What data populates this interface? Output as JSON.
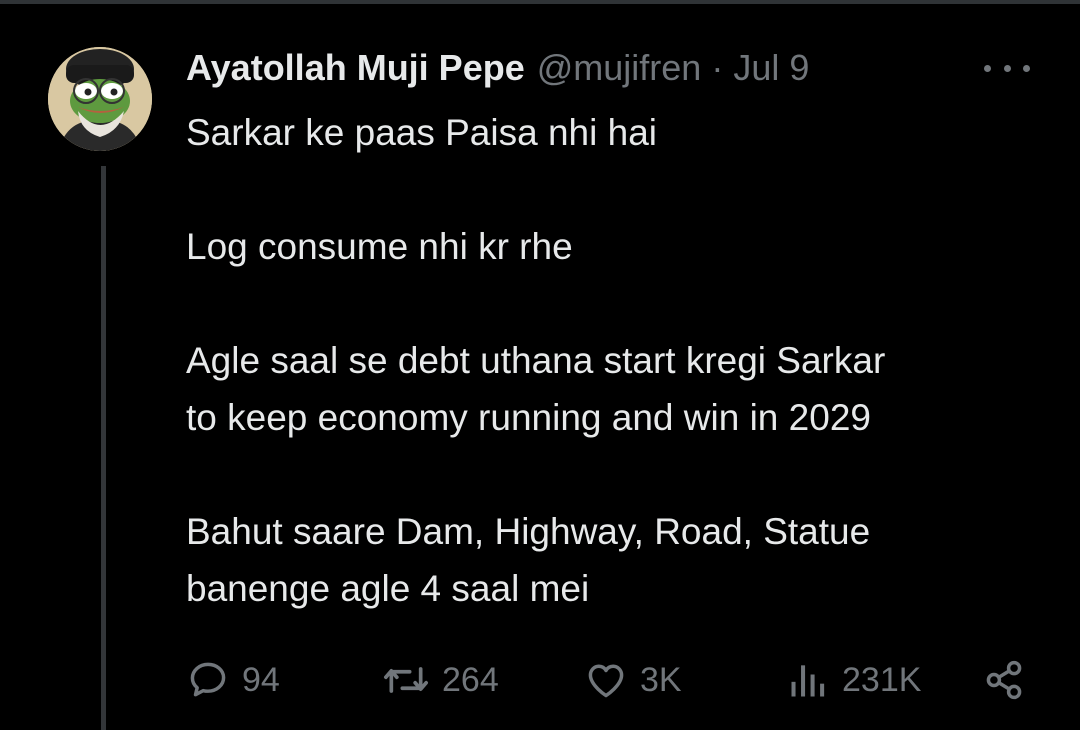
{
  "tweet": {
    "display_name": "Ayatollah Muji Pepe",
    "handle": "@mujifren",
    "separator": "·",
    "date": "Jul 9",
    "avatar_icon": "pepe-frog-avatar",
    "more_icon": "more-horizontal-icon",
    "body": [
      "Sarkar ke paas Paisa nhi hai",
      "Log consume nhi kr rhe",
      "Agle saal se debt uthana start kregi Sarkar",
      "to keep economy running and win in 2029",
      "Bahut saare Dam, Highway, Road, Statue",
      "banenge agle 4 saal mei"
    ]
  },
  "actions": {
    "reply": {
      "icon": "reply-bubble-icon",
      "count": "94"
    },
    "retweet": {
      "icon": "retweet-icon",
      "count": "264"
    },
    "like": {
      "icon": "heart-icon",
      "count": "3K"
    },
    "views": {
      "icon": "views-bar-chart-icon",
      "count": "231K"
    },
    "share": {
      "icon": "share-icon"
    }
  },
  "colors": {
    "background": "#000000",
    "text": "#e7e9ea",
    "secondary": "#71767b",
    "border": "#2f3336"
  }
}
